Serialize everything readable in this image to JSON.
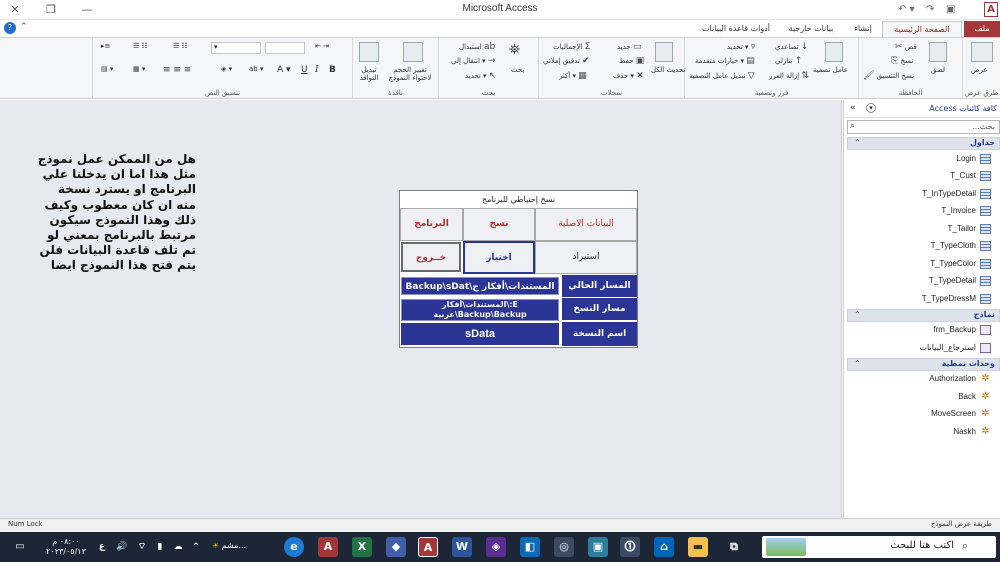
{
  "app": {
    "title": "Microsoft Access",
    "logo_letter": "A"
  },
  "tabs": [
    {
      "label": "ملف"
    },
    {
      "label": "الصفحة الرئيسية"
    },
    {
      "label": "إنشاء"
    },
    {
      "label": "بيانات خارجية"
    },
    {
      "label": "أدوات قاعدة البيانات"
    }
  ],
  "ribbon": {
    "views": {
      "label": "طرق عرض",
      "button": "عرض"
    },
    "clipboard": {
      "label": "الحافظة",
      "paste": "لصق",
      "cut": "قص",
      "copy": "نسخ",
      "format_painter": "نسخ التنسيق"
    },
    "sort_filter": {
      "label": "فرز وتصفية",
      "filter": "عامل تصفية",
      "ascending": "تصاعدي",
      "descending": "تنازلي",
      "remove_sort": "إزالة الفرز",
      "selection": "تحديد",
      "advanced": "خيارات متقدمة",
      "toggle_filter": "تبديل عامل التصفية"
    },
    "records": {
      "label": "سجلات",
      "refresh_all": "تحديث الكل",
      "new": "جديد",
      "save": "حفظ",
      "delete": "حذف",
      "totals": "الإجماليات",
      "spelling": "تدقيق إملائي",
      "more": "أكثر"
    },
    "find": {
      "label": "بحث",
      "find": "بحث",
      "replace": "استبدال",
      "goto": "انتقال إلى",
      "select": "تحديد"
    },
    "window": {
      "label": "نافذة",
      "size_to_fit": "تغيير الحجم لاحتواء النموذج",
      "switch_windows": "تبديل النوافذ"
    },
    "text_formatting": {
      "label": "تنسيق النص",
      "bold": "B",
      "italic": "I",
      "underline": "U"
    }
  },
  "workspace": {
    "note_lines": [
      "هل من الممكن عمل نموذج",
      "مثل هذا اما ان يدخلنا علي",
      "البرنامج او يسترد نسخة",
      "منه ان كان معطوب وكيف",
      "ذلك وهذا النموذج سيكون",
      "مرتبط بالبرنامج بمعني لو",
      "تم تلف قاعدة البيانات فلن",
      "يتم فتح هذا النموذج ايضا"
    ]
  },
  "form": {
    "caption": "نسخ إحتياطي للبرنامج",
    "btn_original_data": "البيانات الاصلية",
    "btn_copy": "نسخ",
    "btn_program": "البرنامج",
    "btn_restore": "استيراد",
    "btn_choose": "اختيار",
    "btn_exit": "خــروج",
    "current_path_label": "المسار الحالي",
    "current_path_value": "المستندات\\أفكار ج\\Backup\\sDat",
    "copy_path_label": "مسار النسخ",
    "copy_path_value_1": "E:\\المستندات\\أفكار",
    "copy_path_value_2": "Backup\\Backup\\عربية",
    "copy_name_label": "اسم النسخة",
    "copy_name_value": "sData"
  },
  "nav": {
    "title": "كافة كائنات Access",
    "search_placeholder": "بحث...",
    "sections": [
      {
        "title": "جداول",
        "items": [
          "Login",
          "T_Cust",
          "T_InTypeDetail",
          "T_Invoice",
          "T_Tailor",
          "T_TypeCloth",
          "T_TypeColor",
          "T_TypeDetail",
          "T_TypeDressM"
        ]
      },
      {
        "title": "نماذج",
        "items": [
          "frm_Backup",
          "استرجاع_البيانات"
        ]
      },
      {
        "title": "وحدات نمطية",
        "items": [
          "Authorization",
          "Back",
          "MoveScreen",
          "Naskh"
        ]
      }
    ]
  },
  "statusbar": {
    "left": "Num Lock",
    "right": "طريقة عرض النموذج"
  },
  "taskbar": {
    "search_text": "اكتب هنا للبحث",
    "time": "٠٨:٠٠ م",
    "date": "٢٠٢٣/٠٥/١٣",
    "weather": "مشم...",
    "lang": "ع"
  },
  "colors": {
    "accent": "#a4373a",
    "form_blue": "#2b3595",
    "red_text": "#c0272d"
  }
}
